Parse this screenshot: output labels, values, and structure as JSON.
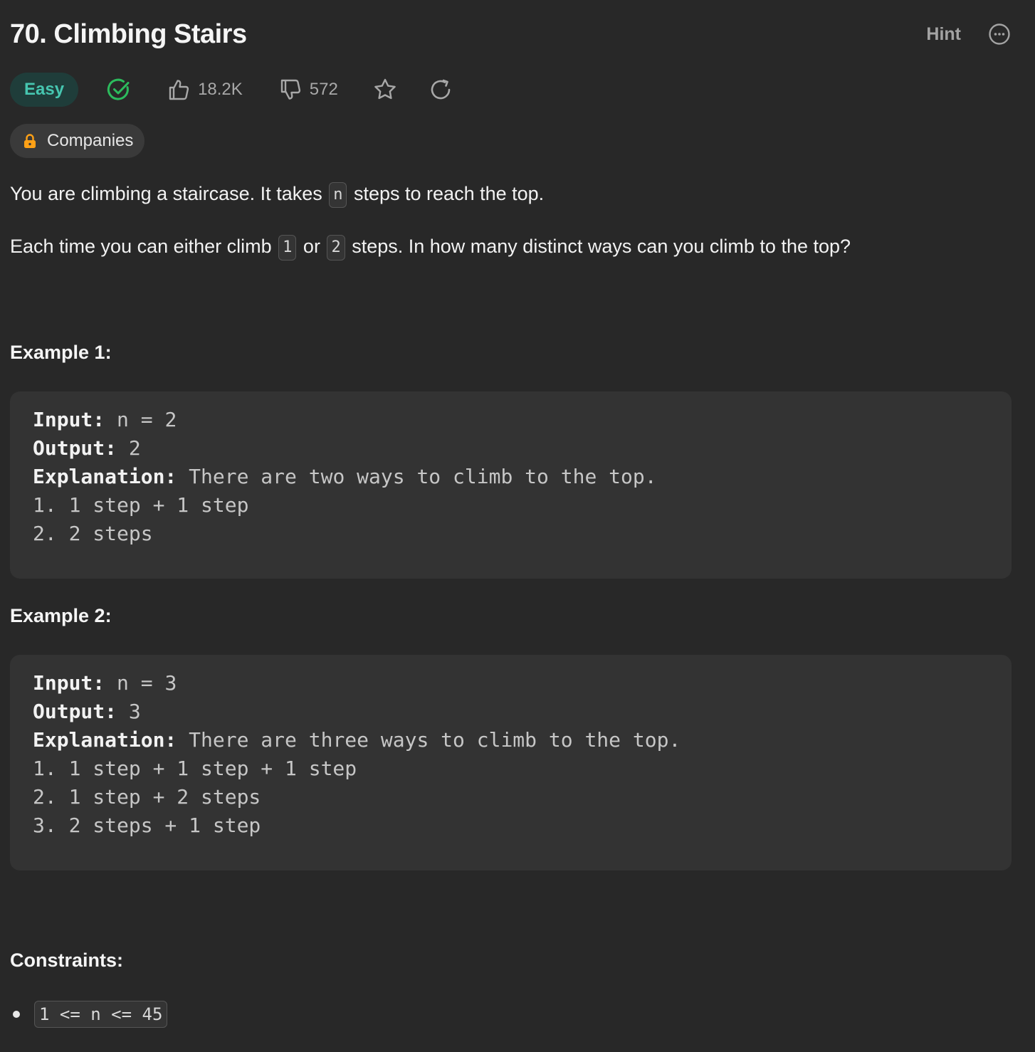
{
  "problem": {
    "title": "70. Climbing Stairs",
    "hint_label": "Hint",
    "difficulty": "Easy",
    "likes": "18.2K",
    "dislikes": "572",
    "companies_label": "Companies"
  },
  "description": {
    "p1_before": "You are climbing a staircase. It takes ",
    "p1_code": "n",
    "p1_after": " steps to reach the top.",
    "p2_before": "Each time you can either climb ",
    "p2_code1": "1",
    "p2_mid": " or ",
    "p2_code2": "2",
    "p2_after": " steps. In how many distinct ways can you climb to the top?"
  },
  "examples": [
    {
      "heading": "Example 1:",
      "input_label": "Input:",
      "input_value": " n = 2",
      "output_label": "Output:",
      "output_value": " 2",
      "explanation_label": "Explanation:",
      "explanation_value": " There are two ways to climb to the top.",
      "steps": [
        "1. 1 step + 1 step",
        "2. 2 steps"
      ]
    },
    {
      "heading": "Example 2:",
      "input_label": "Input:",
      "input_value": " n = 3",
      "output_label": "Output:",
      "output_value": " 3",
      "explanation_label": "Explanation:",
      "explanation_value": " There are three ways to climb to the top.",
      "steps": [
        "1. 1 step + 1 step + 1 step",
        "2. 1 step + 2 steps",
        "3. 2 steps + 1 step"
      ]
    }
  ],
  "constraints": {
    "heading": "Constraints:",
    "items": [
      "1 <= n <= 45"
    ]
  },
  "colors": {
    "background": "#282828",
    "easy_text": "#46c6b0",
    "easy_bg": "#1f3d3a",
    "solved_check": "#2cbb5d",
    "lock": "#ffa116"
  },
  "icons": {
    "more": "more-horizontal-circle-icon",
    "solved": "check-circle-icon",
    "like": "thumbs-up-icon",
    "dislike": "thumbs-down-icon",
    "favorite": "star-icon",
    "refresh": "refresh-icon",
    "lock": "lock-icon"
  }
}
